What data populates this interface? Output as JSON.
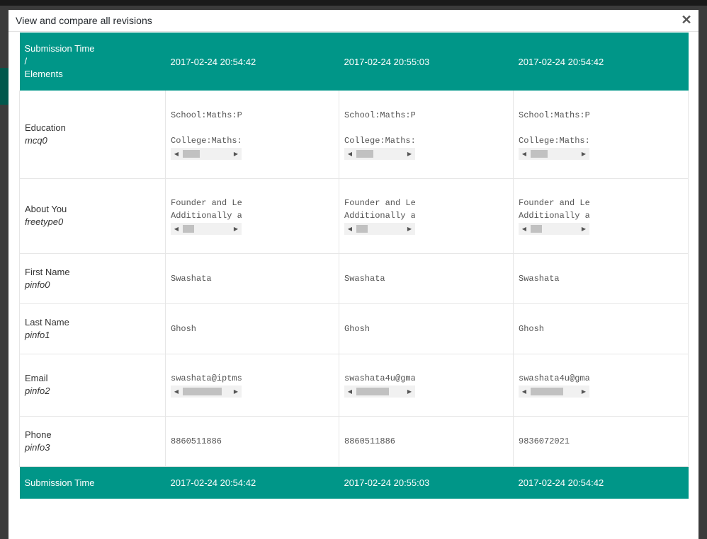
{
  "modal": {
    "title": "View and compare all revisions",
    "close_label": "✕"
  },
  "table": {
    "header_label_line1": "Submission Time",
    "header_label_line2": "/",
    "header_label_line3": "Elements",
    "revisions": [
      "2017-02-24 20:54:42",
      "2017-02-24 20:55:03",
      "2017-02-24 20:54:42"
    ],
    "footer_label": "Submission Time",
    "rows": [
      {
        "label": "Education",
        "key": "mcq0",
        "values": [
          {
            "line1": "School:Maths:P",
            "line2": "College:Maths:"
          },
          {
            "line1": "School:Maths:P",
            "line2": "College:Maths:"
          },
          {
            "line1": "School:Maths:P",
            "line2": "College:Maths:"
          }
        ]
      },
      {
        "label": "About You",
        "key": "freetype0",
        "values": [
          {
            "line1": "Founder and Le",
            "line2": "Additionally a"
          },
          {
            "line1": "Founder and Le",
            "line2": "Additionally a"
          },
          {
            "line1": "Founder and Le",
            "line2": "Additionally a"
          }
        ]
      },
      {
        "label": "First Name",
        "key": "pinfo0",
        "values": [
          "Swashata",
          "Swashata",
          "Swashata"
        ]
      },
      {
        "label": "Last Name",
        "key": "pinfo1",
        "values": [
          "Ghosh",
          "Ghosh",
          "Ghosh"
        ]
      },
      {
        "label": "Email",
        "key": "pinfo2",
        "values": [
          "swashata@iptms",
          "swashata4u@gma",
          "swashata4u@gma"
        ]
      },
      {
        "label": "Phone",
        "key": "pinfo3",
        "values": [
          "8860511886",
          "8860511886",
          "9836072021"
        ]
      }
    ]
  },
  "colors": {
    "header_bg": "#009688",
    "overlay_bg": "#3b3b3b"
  }
}
